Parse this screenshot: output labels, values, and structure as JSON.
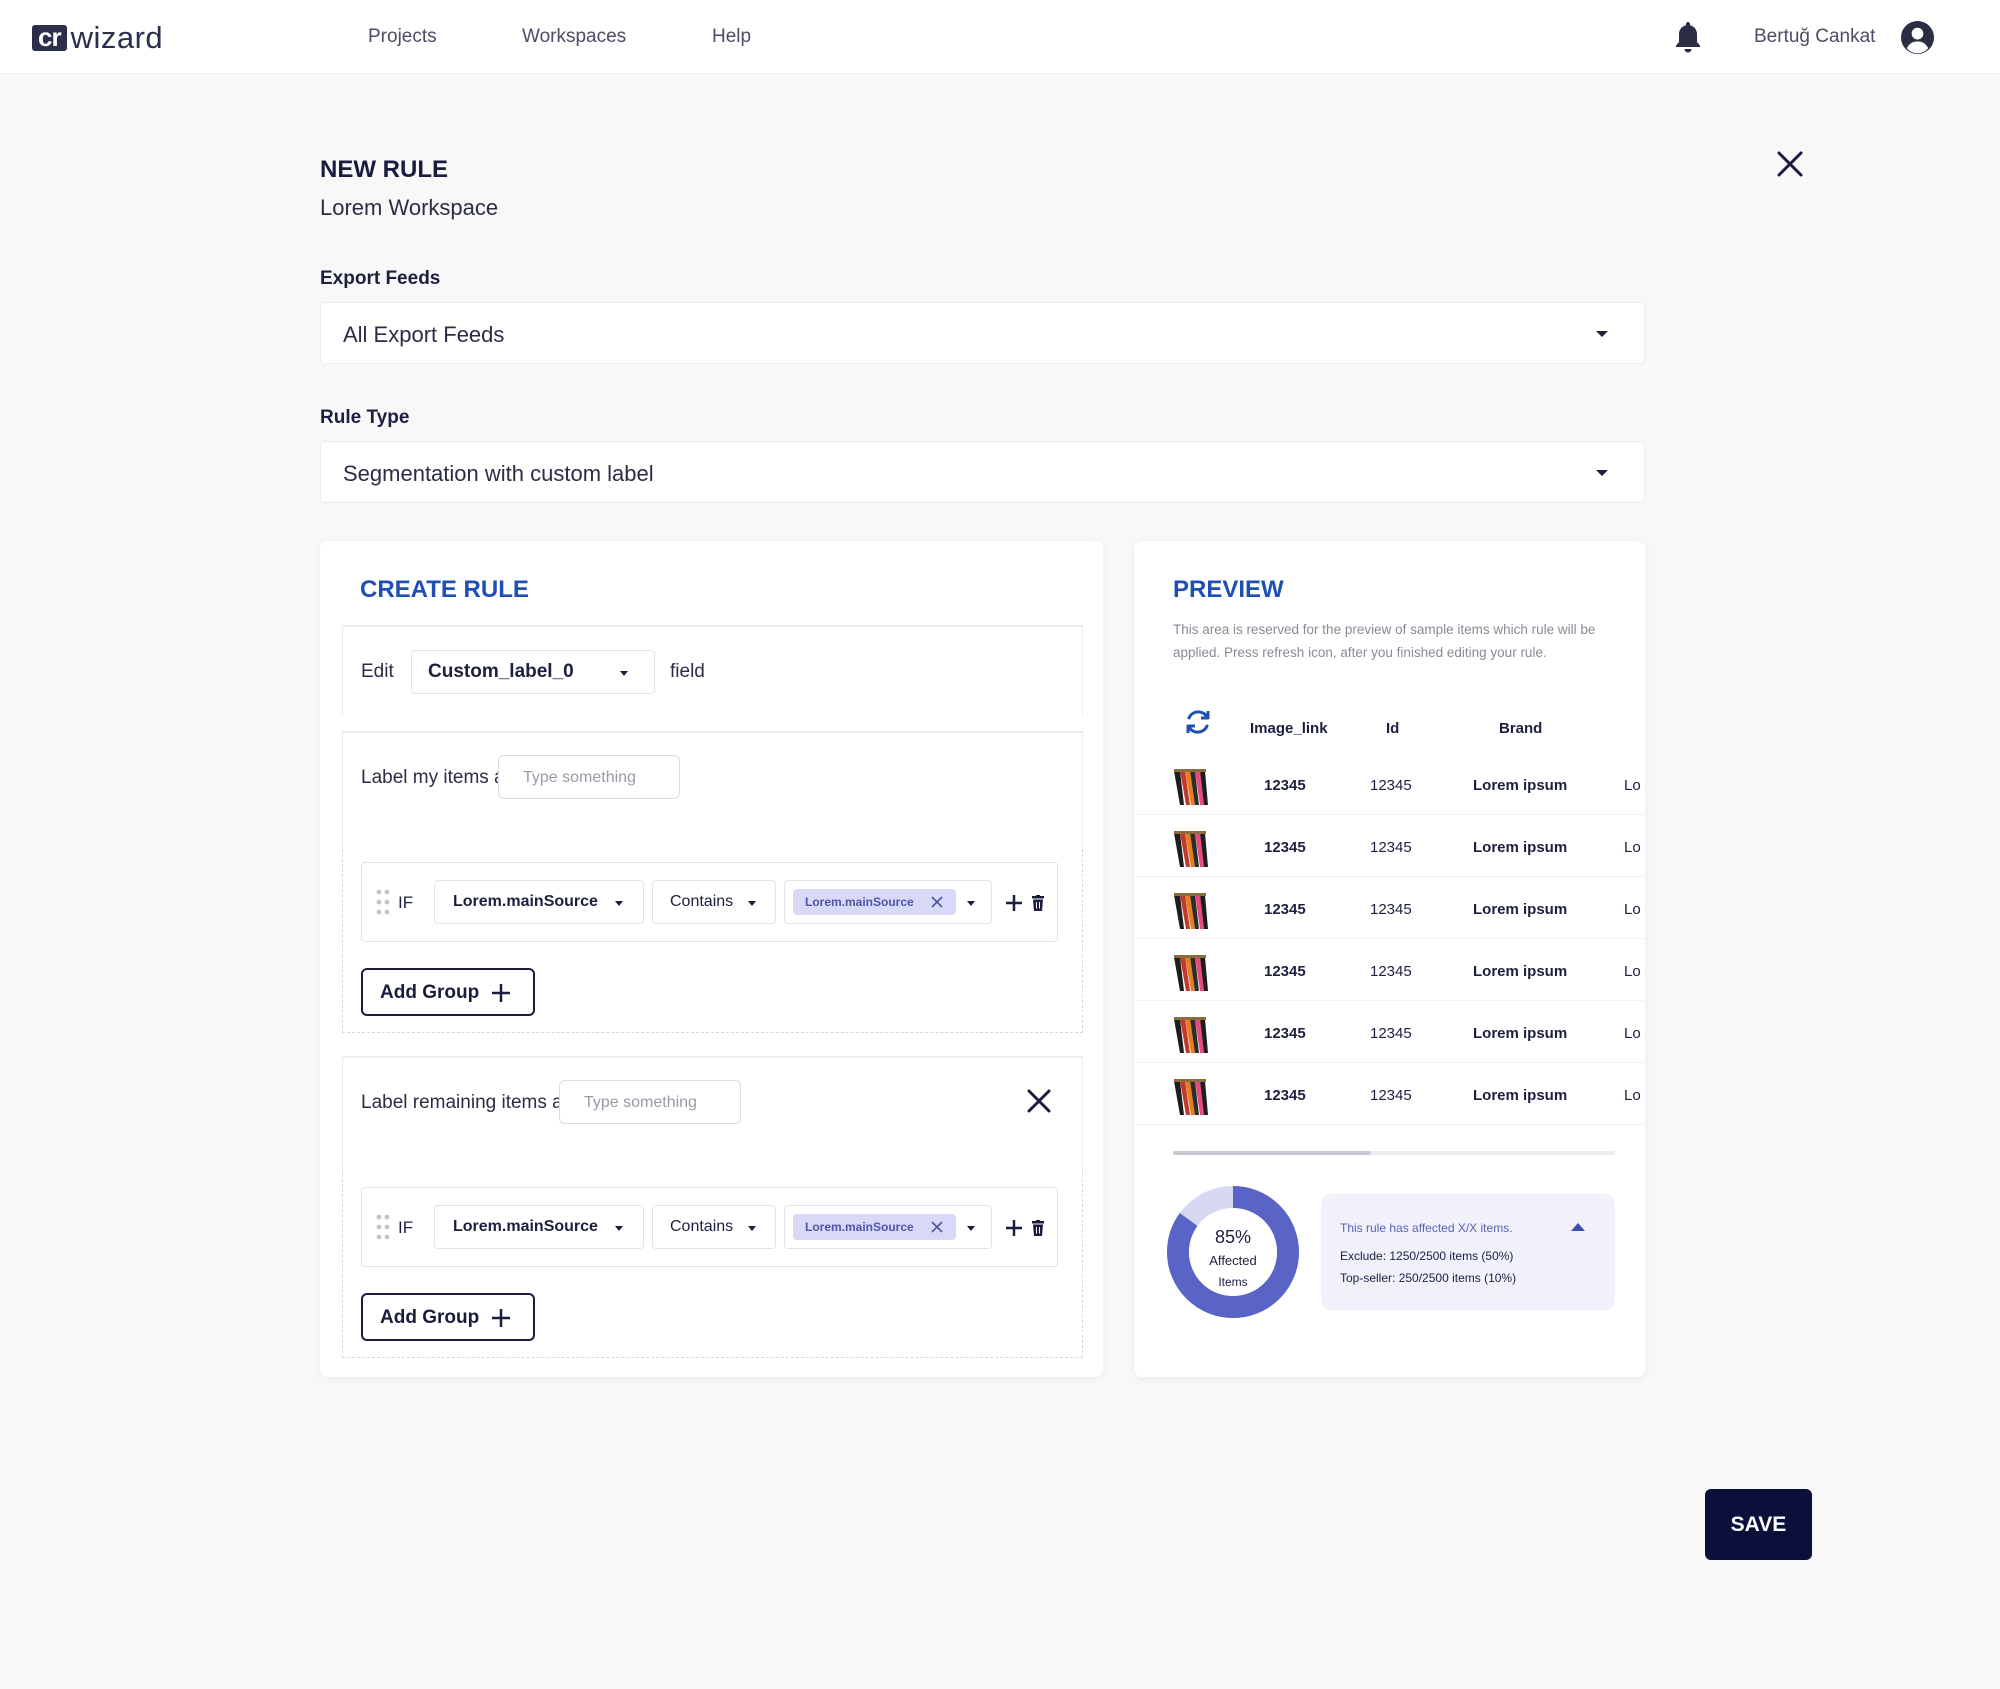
{
  "header": {
    "logo_box": "cr",
    "logo_text": "wizard",
    "nav": [
      "Projects",
      "Workspaces",
      "Help"
    ],
    "user_name": "Bertuğ Cankat"
  },
  "page": {
    "title": "NEW RULE",
    "subtitle": "Lorem Workspace"
  },
  "export_feeds": {
    "label": "Export Feeds",
    "value": "All Export Feeds"
  },
  "rule_type": {
    "label": "Rule Type",
    "value": "Segmentation with custom label"
  },
  "create_rule": {
    "title": "CREATE RULE",
    "edit_label": "Edit",
    "edit_field_value": "Custom_label_0",
    "field_label": "field",
    "label_items_as": "Label my items as",
    "label_remaining_as": "Label remaining items as",
    "input_placeholder": "Type something",
    "if_label": "IF",
    "source_value": "Lorem.mainSource",
    "operator_value": "Contains",
    "chip_value": "Lorem.mainSource",
    "add_group_label": "Add Group"
  },
  "preview": {
    "title": "PREVIEW",
    "description": "This area is reserved for the preview of sample items which rule will be applied. Press refresh icon, after you finished editing your rule.",
    "columns": [
      "Image_link",
      "Id",
      "Brand"
    ],
    "rows": [
      {
        "image_link": "12345",
        "id": "12345",
        "brand": "Lorem ipsum",
        "extra": "Lo"
      },
      {
        "image_link": "12345",
        "id": "12345",
        "brand": "Lorem ipsum",
        "extra": "Lo"
      },
      {
        "image_link": "12345",
        "id": "12345",
        "brand": "Lorem ipsum",
        "extra": "Lo"
      },
      {
        "image_link": "12345",
        "id": "12345",
        "brand": "Lorem ipsum",
        "extra": "Lo"
      },
      {
        "image_link": "12345",
        "id": "12345",
        "brand": "Lorem ipsum",
        "extra": "Lo"
      },
      {
        "image_link": "12345",
        "id": "12345",
        "brand": "Lorem ipsum",
        "extra": "Lo"
      }
    ],
    "affected_percent": "85%",
    "affected_fraction": 0.85,
    "affected_label_1": "Affected",
    "affected_label_2": "Items",
    "info_title": "This rule has affected X/X items.",
    "info_lines": [
      "Exclude: 1250/2500 items (50%)",
      "Top-seller: 250/2500 items (10%)"
    ]
  },
  "save_label": "SAVE",
  "colors": {
    "accent_blue": "#1e50b4",
    "donut_fill": "#5a63c6",
    "donut_track": "#d7d9f2",
    "save_bg": "#0b0f3a"
  }
}
